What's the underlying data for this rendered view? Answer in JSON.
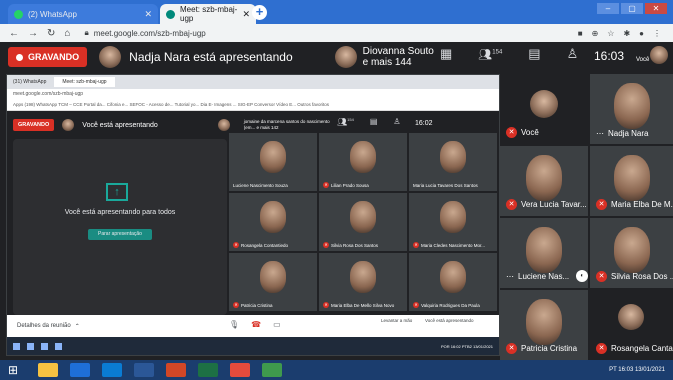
{
  "browser": {
    "tabs": [
      {
        "label": "(2) WhatsApp",
        "active": false
      },
      {
        "label": "Meet: szb-mbaj-ugp",
        "active": true
      }
    ],
    "url": "meet.google.com/szb-mbaj-ugp"
  },
  "meet": {
    "recording_label": "GRAVANDO",
    "presenting_text": "Nadja Nara está apresentando",
    "participant_summary": {
      "name": "Diovanna Souto",
      "others": "e mais 144"
    },
    "participant_count": "154",
    "time": "16:03",
    "self_label": "Você"
  },
  "inner": {
    "tabs": [
      "(31) WhatsApp",
      "Meet: szb-mbaj-ugp"
    ],
    "url": "meet.google.com/szb-mbaj-ugp",
    "bookmarks": "Apps  (198) WhatsApp  TCM – CCE  Portal da... Cifonia e...  SEFOC - Acesso de...  Tutorial yo...  Dia E-  Imagens ...  SIG-EP  Conversor Vídeo E...  Outros favoritos",
    "recording_label": "GRAVANDO",
    "presenting_text": "Você está apresentando",
    "participant_summary": "jomaine da marcena santos do nascimento (em... e mais 142",
    "participant_count": "154",
    "time": "16:02",
    "panel_text": "Você está apresentando para todos",
    "stop_button": "Parar apresentação",
    "grid": [
      "Luciene Nascimento Souza",
      "Lilian Prado Sousa",
      "Maria Lucia Tavares Dos Santos",
      "Rosangela Contantiedo",
      "Silvia Rosa Dos Santos",
      "Maria Cledes Nascimento Mor...",
      "Patricia Cristina",
      "Maria Elba De Mello Silva Novo",
      "Valquiria Rodrigues Da Paula"
    ],
    "meeting_details": "Detalhes da reunião",
    "raise_hand": "Levantar a mão",
    "you_presenting": "Você está apresentando",
    "sys_tray": "POR 16:02 PTB2 13/01/2021"
  },
  "right_tiles": [
    {
      "name": ""
    },
    {
      "name": "Você"
    },
    {
      "name": "Nadja Nara"
    },
    {
      "name": "Vera Lucia Tavar..."
    },
    {
      "name": "Maria Elba De M..."
    },
    {
      "name": "Luciene Nas..."
    },
    {
      "name": "Silvia Rosa Dos ..."
    },
    {
      "name": "Patricia Cristina"
    },
    {
      "name": "Rosangela Canta..."
    }
  ],
  "taskbar": {
    "tray_text": "PT 16:03 13/01/2021"
  }
}
